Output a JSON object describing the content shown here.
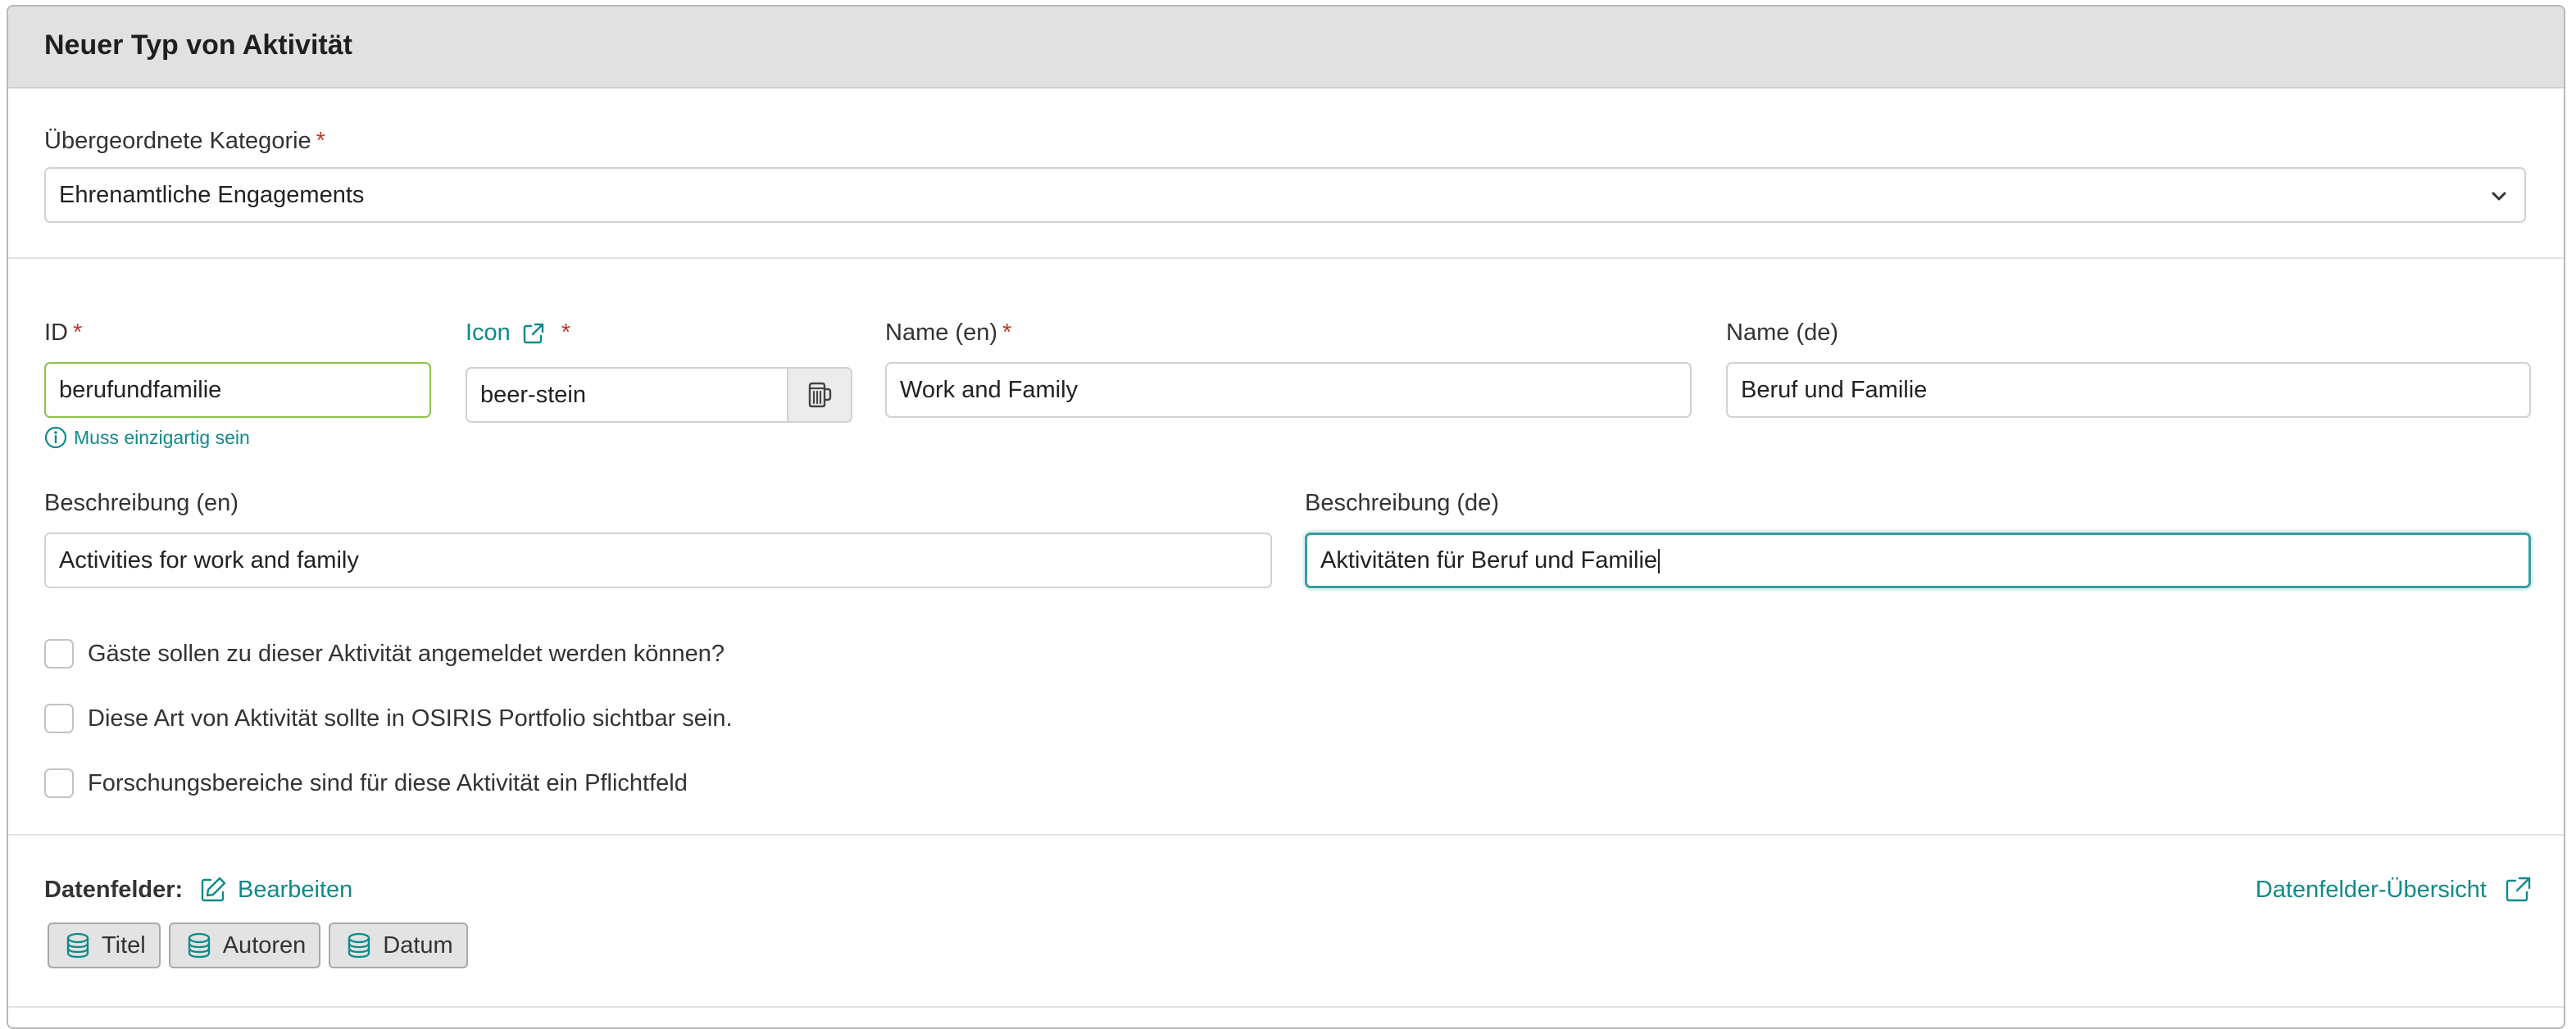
{
  "card": {
    "title": "Neuer Typ von Aktivität"
  },
  "category": {
    "label": "Übergeordnete Kategorie",
    "required_mark": "*",
    "value": "Ehrenamtliche Engagements"
  },
  "id_field": {
    "label": "ID",
    "required_mark": "*",
    "value": "berufundfamilie",
    "hint": "Muss einzigartig sein"
  },
  "icon_field": {
    "label": "Icon",
    "required_mark": "*",
    "value": "beer-stein",
    "preview_icon": "beer-stein-icon"
  },
  "name_en": {
    "label": "Name (en)",
    "required_mark": "*",
    "value": "Work and Family"
  },
  "name_de": {
    "label": "Name (de)",
    "value": "Beruf und Familie"
  },
  "desc_en": {
    "label": "Beschreibung (en)",
    "value": "Activities for work and family"
  },
  "desc_de": {
    "label": "Beschreibung (de)",
    "value": "Aktivitäten für Beruf und Familie"
  },
  "checkboxes": [
    {
      "label": "Gäste sollen zu dieser Aktivität angemeldet werden können?",
      "checked": false
    },
    {
      "label": "Diese Art von Aktivität sollte in OSIRIS Portfolio sichtbar sein.",
      "checked": false
    },
    {
      "label": "Forschungsbereiche sind für diese Aktivität ein Pflichtfeld",
      "checked": false
    }
  ],
  "datafields": {
    "label": "Datenfelder:",
    "edit_label": "Bearbeiten",
    "overview_label": "Datenfelder-Übersicht",
    "chips": [
      "Titel",
      "Autoren",
      "Datum"
    ]
  },
  "colors": {
    "accent": "#0f8a8a",
    "required": "#c0392b",
    "valid_border": "#8bc34a",
    "header_bg": "#e1e1e1"
  }
}
